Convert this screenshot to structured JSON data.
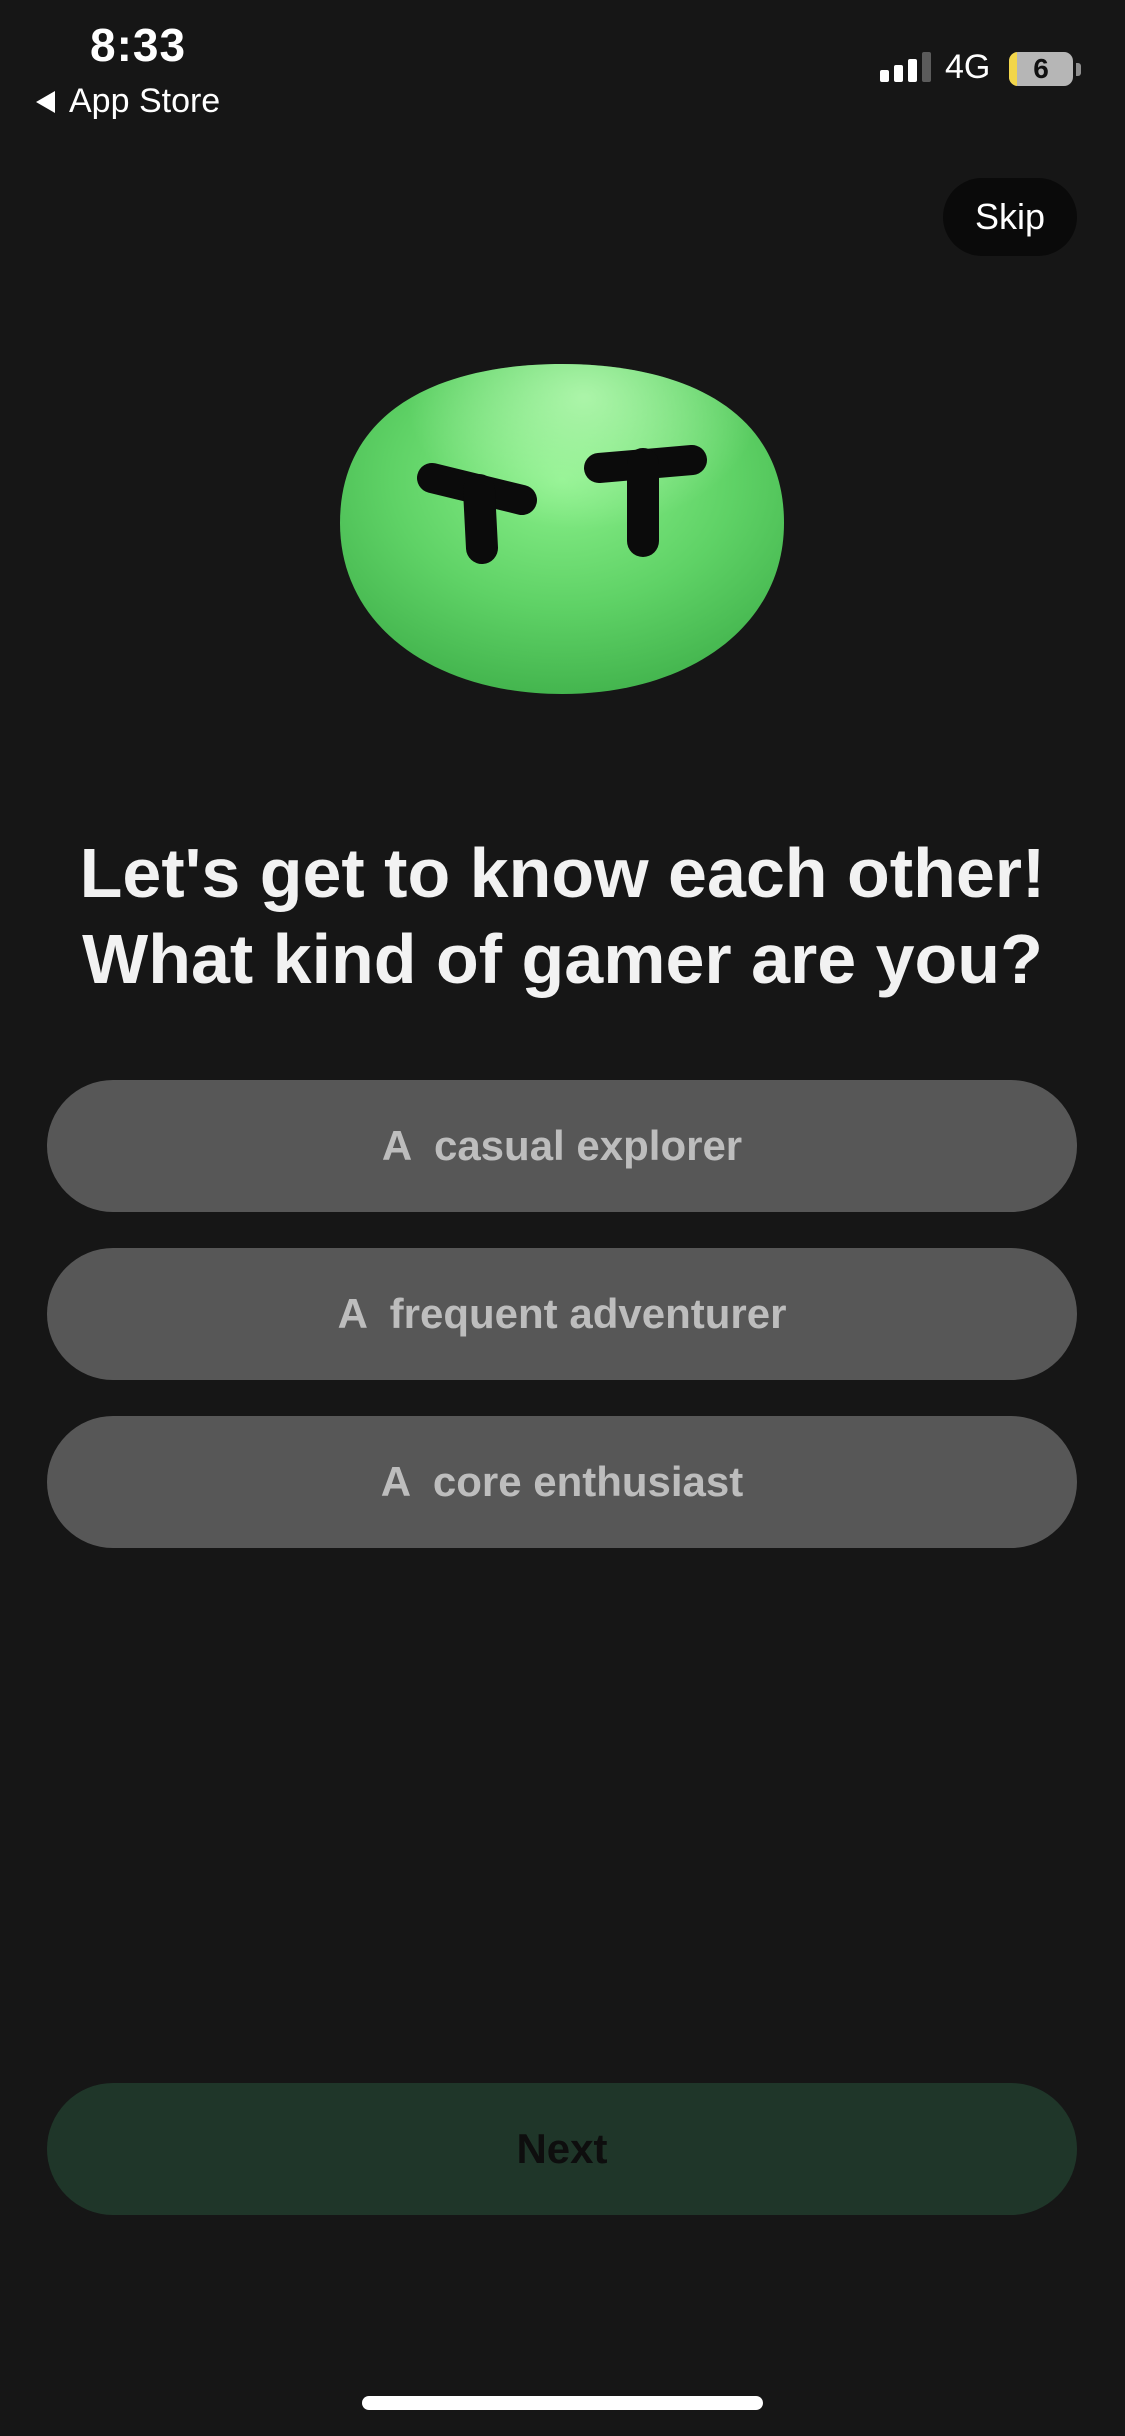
{
  "status_bar": {
    "time": "8:33",
    "back_label": "App Store",
    "network": "4G",
    "battery": "6"
  },
  "skip_label": "Skip",
  "heading": {
    "line1": "Let's get to know each other!",
    "line2": "What kind of gamer are you?"
  },
  "options": [
    {
      "label": "A  casual explorer"
    },
    {
      "label": "A  frequent adventurer"
    },
    {
      "label": "A  core enthusiast"
    }
  ],
  "next_label": "Next",
  "colors": {
    "background": "#161616",
    "option_bg": "#575757",
    "option_text": "#bdbdbd",
    "next_bg": "#1f3629",
    "mascot_green": "#5fd266"
  },
  "icons": {
    "mascot": "green-blob-face-icon",
    "back": "back-arrow-icon",
    "signal": "cellular-signal-icon",
    "battery": "battery-icon"
  }
}
